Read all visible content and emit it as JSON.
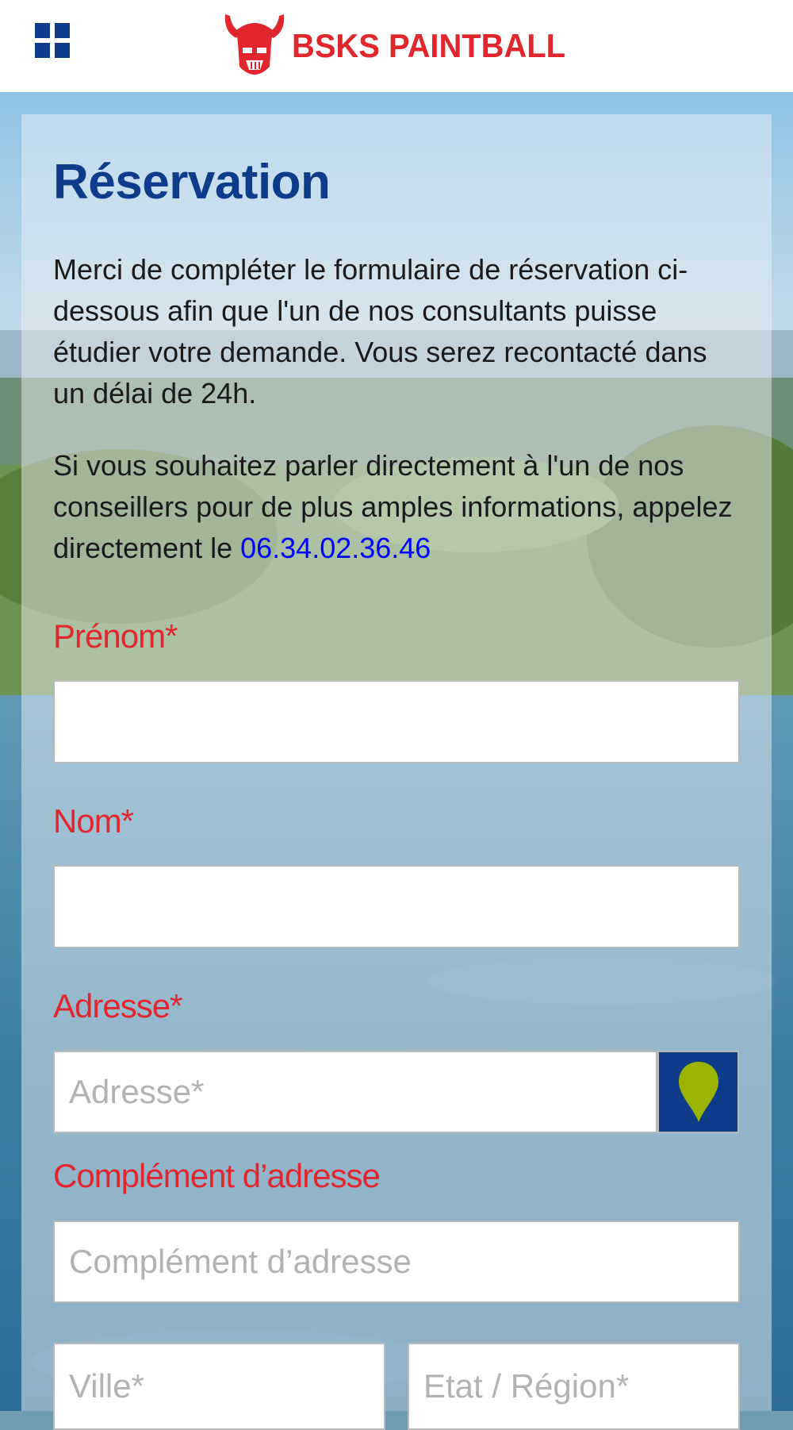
{
  "header": {
    "logo_text": "BSKS PAINTBALL",
    "menu_icon": "grid-icon"
  },
  "colors": {
    "brand_red": "#e2262e",
    "brand_blue": "#0e3c8a",
    "accent_green": "#9bb400",
    "link_blue": "#0000ff"
  },
  "main": {
    "title": "Réservation",
    "intro": "Merci de compléter le formulaire de réservation ci-dessous afin que l'un de nos consultants puisse étudier votre demande. Vous serez recontacté dans un délai de 24h.",
    "contact_prefix": "Si vous souhaitez parler directement à l'un de nos conseillers pour de plus amples informations, appelez directement le ",
    "phone": "06.34.02.36.46"
  },
  "form": {
    "prenom_label": "Prénom*",
    "prenom_value": "",
    "nom_label": "Nom*",
    "nom_value": "",
    "adresse_label": "Adresse*",
    "adresse_placeholder": "Adresse*",
    "locate_icon": "map-pin-icon",
    "complement_label": "Complément d’adresse",
    "complement_placeholder": "Complément d’adresse",
    "ville_placeholder": "Ville*",
    "region_placeholder": "Etat / Région*"
  }
}
